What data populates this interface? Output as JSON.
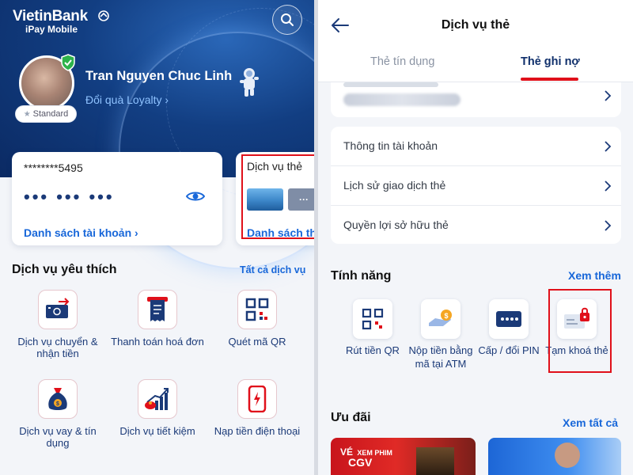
{
  "left": {
    "brand_name": "VietinBank",
    "brand_sub": "iPay Mobile",
    "user_name": "Tran Nguyen Chuc Linh",
    "loyalty_link": "Đổi quà Loyalty ›",
    "tier_badge": "Standard",
    "account": {
      "masked_number": "********5495",
      "hidden_balance": "••• ••• •••",
      "link": "Danh sách tài khoản ›"
    },
    "card_service": {
      "title": "Dịch vụ thẻ",
      "link": "Danh sách thẻ",
      "more_glyph": "···"
    },
    "favorites": {
      "title": "Dịch vụ yêu thích",
      "all_link": "Tất cả dịch vụ",
      "items": [
        {
          "label": "Dịch vụ chuyển & nhận tiền",
          "icon": "transfer-money-icon"
        },
        {
          "label": "Thanh toán hoá đơn",
          "icon": "bill-payment-icon"
        },
        {
          "label": "Quét mã QR",
          "icon": "qr-scan-icon"
        },
        {
          "label": "Dịch vụ vay & tín dụng",
          "icon": "loan-bag-icon"
        },
        {
          "label": "Dịch vụ tiết kiệm",
          "icon": "savings-growth-icon"
        },
        {
          "label": "Nạp tiền điện thoại",
          "icon": "phone-topup-icon"
        }
      ]
    }
  },
  "right": {
    "title": "Dịch vụ thẻ",
    "tabs": [
      {
        "label": "Thẻ tín dụng",
        "active": false
      },
      {
        "label": "Thẻ ghi nợ",
        "active": true
      }
    ],
    "menu": [
      {
        "label": "Thông tin tài khoản"
      },
      {
        "label": "Lịch sử giao dịch thẻ"
      },
      {
        "label": "Quyền lợi sở hữu thẻ"
      }
    ],
    "features": {
      "title": "Tính năng",
      "more_link": "Xem thêm",
      "items": [
        {
          "label": "Rút tiền QR",
          "icon": "qr-withdraw-icon"
        },
        {
          "label": "Nộp tiền bằng mã tại ATM",
          "icon": "atm-deposit-icon"
        },
        {
          "label": "Cấp / đổi PIN",
          "icon": "pin-code-icon"
        },
        {
          "label": "Tạm khoá thẻ",
          "icon": "card-lock-icon"
        }
      ]
    },
    "offers": {
      "title": "Ưu đãi",
      "all_link": "Xem tất cả",
      "promo1_text_top": "VÉ",
      "promo1_text_mid": "XEM PHIM",
      "promo1_text_bottom": "CGV"
    }
  },
  "colors": {
    "brand_blue": "#0b2a63",
    "link_blue": "#1867d9",
    "highlight_red": "#e0101a",
    "tab_active": "#0f2f6b"
  }
}
